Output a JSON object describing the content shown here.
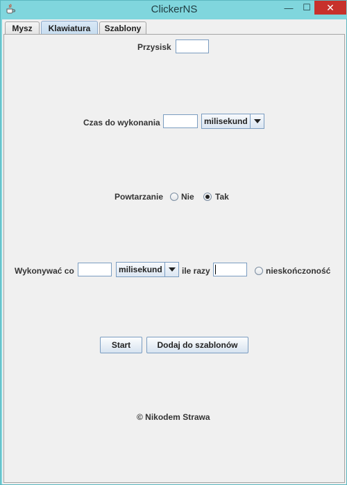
{
  "window": {
    "title": "ClickerNS",
    "minimize_glyph": "—",
    "maximize_glyph": "☐",
    "close_glyph": "✕"
  },
  "tabs": [
    {
      "label": "Mysz",
      "active": false
    },
    {
      "label": "Klawiatura",
      "active": true
    },
    {
      "label": "Szablony",
      "active": false
    }
  ],
  "form": {
    "key_label": "Przysisk",
    "key_value": "",
    "delay_label": "Czas do wykonania",
    "delay_value": "",
    "delay_unit": "milisekund",
    "repeat_label": "Powtarzanie",
    "repeat_no": "Nie",
    "repeat_yes": "Tak",
    "repeat_selected": "Tak",
    "interval_label": "Wykonywać co",
    "interval_value": "",
    "interval_unit": "milisekund",
    "times_label": "ile razy",
    "times_value": "",
    "infinity_label": "nieskończoność",
    "infinity_selected": false
  },
  "buttons": {
    "start": "Start",
    "add_template": "Dodaj do szablonów"
  },
  "footer": {
    "copyright": "© Nikodem Strawa"
  },
  "icons": {
    "app": "java-cup-icon",
    "dropdown": "triangle-down-icon"
  }
}
